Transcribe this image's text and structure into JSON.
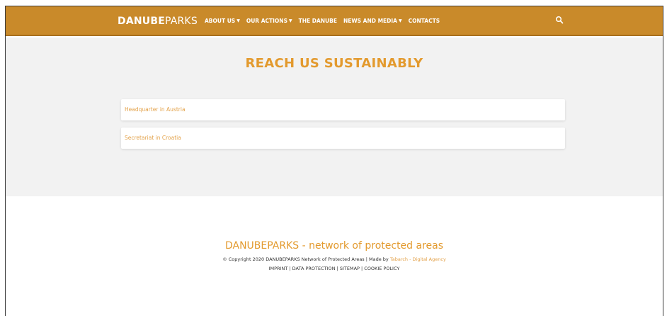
{
  "header": {
    "logo_bold": "DANUBE",
    "logo_light": "PARKS",
    "nav": [
      {
        "label": "ABOUT US",
        "dropdown": true
      },
      {
        "label": "OUR ACTIONS",
        "dropdown": true
      },
      {
        "label": "THE DANUBE",
        "dropdown": false
      },
      {
        "label": "NEWS AND MEDIA",
        "dropdown": true
      },
      {
        "label": "CONTACTS",
        "dropdown": false
      }
    ],
    "search_icon": "search-icon"
  },
  "main": {
    "title": "REACH US SUSTAINABLY",
    "items": [
      {
        "label": "Headquarter in Austria"
      },
      {
        "label": "Secretariat in Croatia"
      }
    ]
  },
  "footer": {
    "title": "DANUBEPARKS - network of protected areas",
    "copyright_text": "© Copyright 2020 DANUBEPARKS Network of Protected Areas | Made by ",
    "agency": "Tabarch - Digital Agency",
    "links": [
      "IMPRINT",
      "DATA PROTECTION",
      "SITEMAP",
      "COOKIE POLICY"
    ],
    "separator": " | "
  },
  "colors": {
    "brand": "#c98a2a",
    "accent": "#e39a2e",
    "background": "#f2f2f2"
  }
}
